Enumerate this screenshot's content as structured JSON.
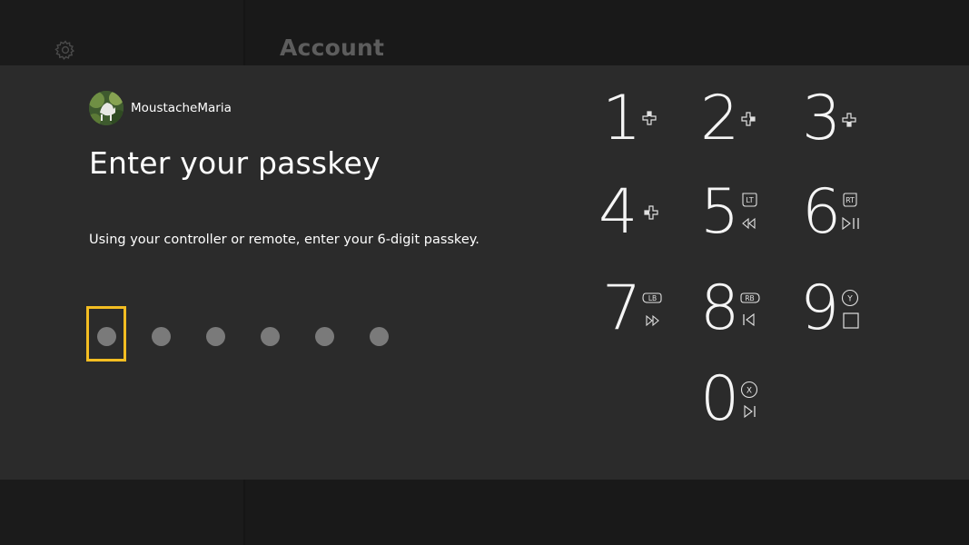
{
  "page": {
    "title": "Account"
  },
  "user": {
    "gamertag": "MoustacheMaria"
  },
  "dialog": {
    "heading": "Enter your passkey",
    "instructions": "Using your controller or remote, enter your 6-digit passkey.",
    "pin_length": 6,
    "entered_digits": 0
  },
  "keypad": {
    "keys": [
      {
        "digit": "1",
        "hint_icon": "dpad-up-icon"
      },
      {
        "digit": "2",
        "hint_icon": "dpad-right-icon"
      },
      {
        "digit": "3",
        "hint_icon": "dpad-down-icon"
      },
      {
        "digit": "4",
        "hint_icon": "dpad-left-icon"
      },
      {
        "digit": "5",
        "hint_button": "LT",
        "hint_icon": "rewind-icon"
      },
      {
        "digit": "6",
        "hint_button": "RT",
        "hint_icon": "play-pause-icon"
      },
      {
        "digit": "7",
        "hint_button": "LB",
        "hint_icon": "fast-forward-icon"
      },
      {
        "digit": "8",
        "hint_button": "RB",
        "hint_icon": "skip-back-icon"
      },
      {
        "digit": "9",
        "hint_button": "Y",
        "hint_icon": "stop-icon"
      },
      {
        "digit": "0",
        "hint_button": "X",
        "hint_icon": "skip-forward-icon"
      }
    ]
  },
  "colors": {
    "focus": "#f3bd22",
    "dialog_bg": "#2b2b2b",
    "page_bg": "#191919"
  }
}
